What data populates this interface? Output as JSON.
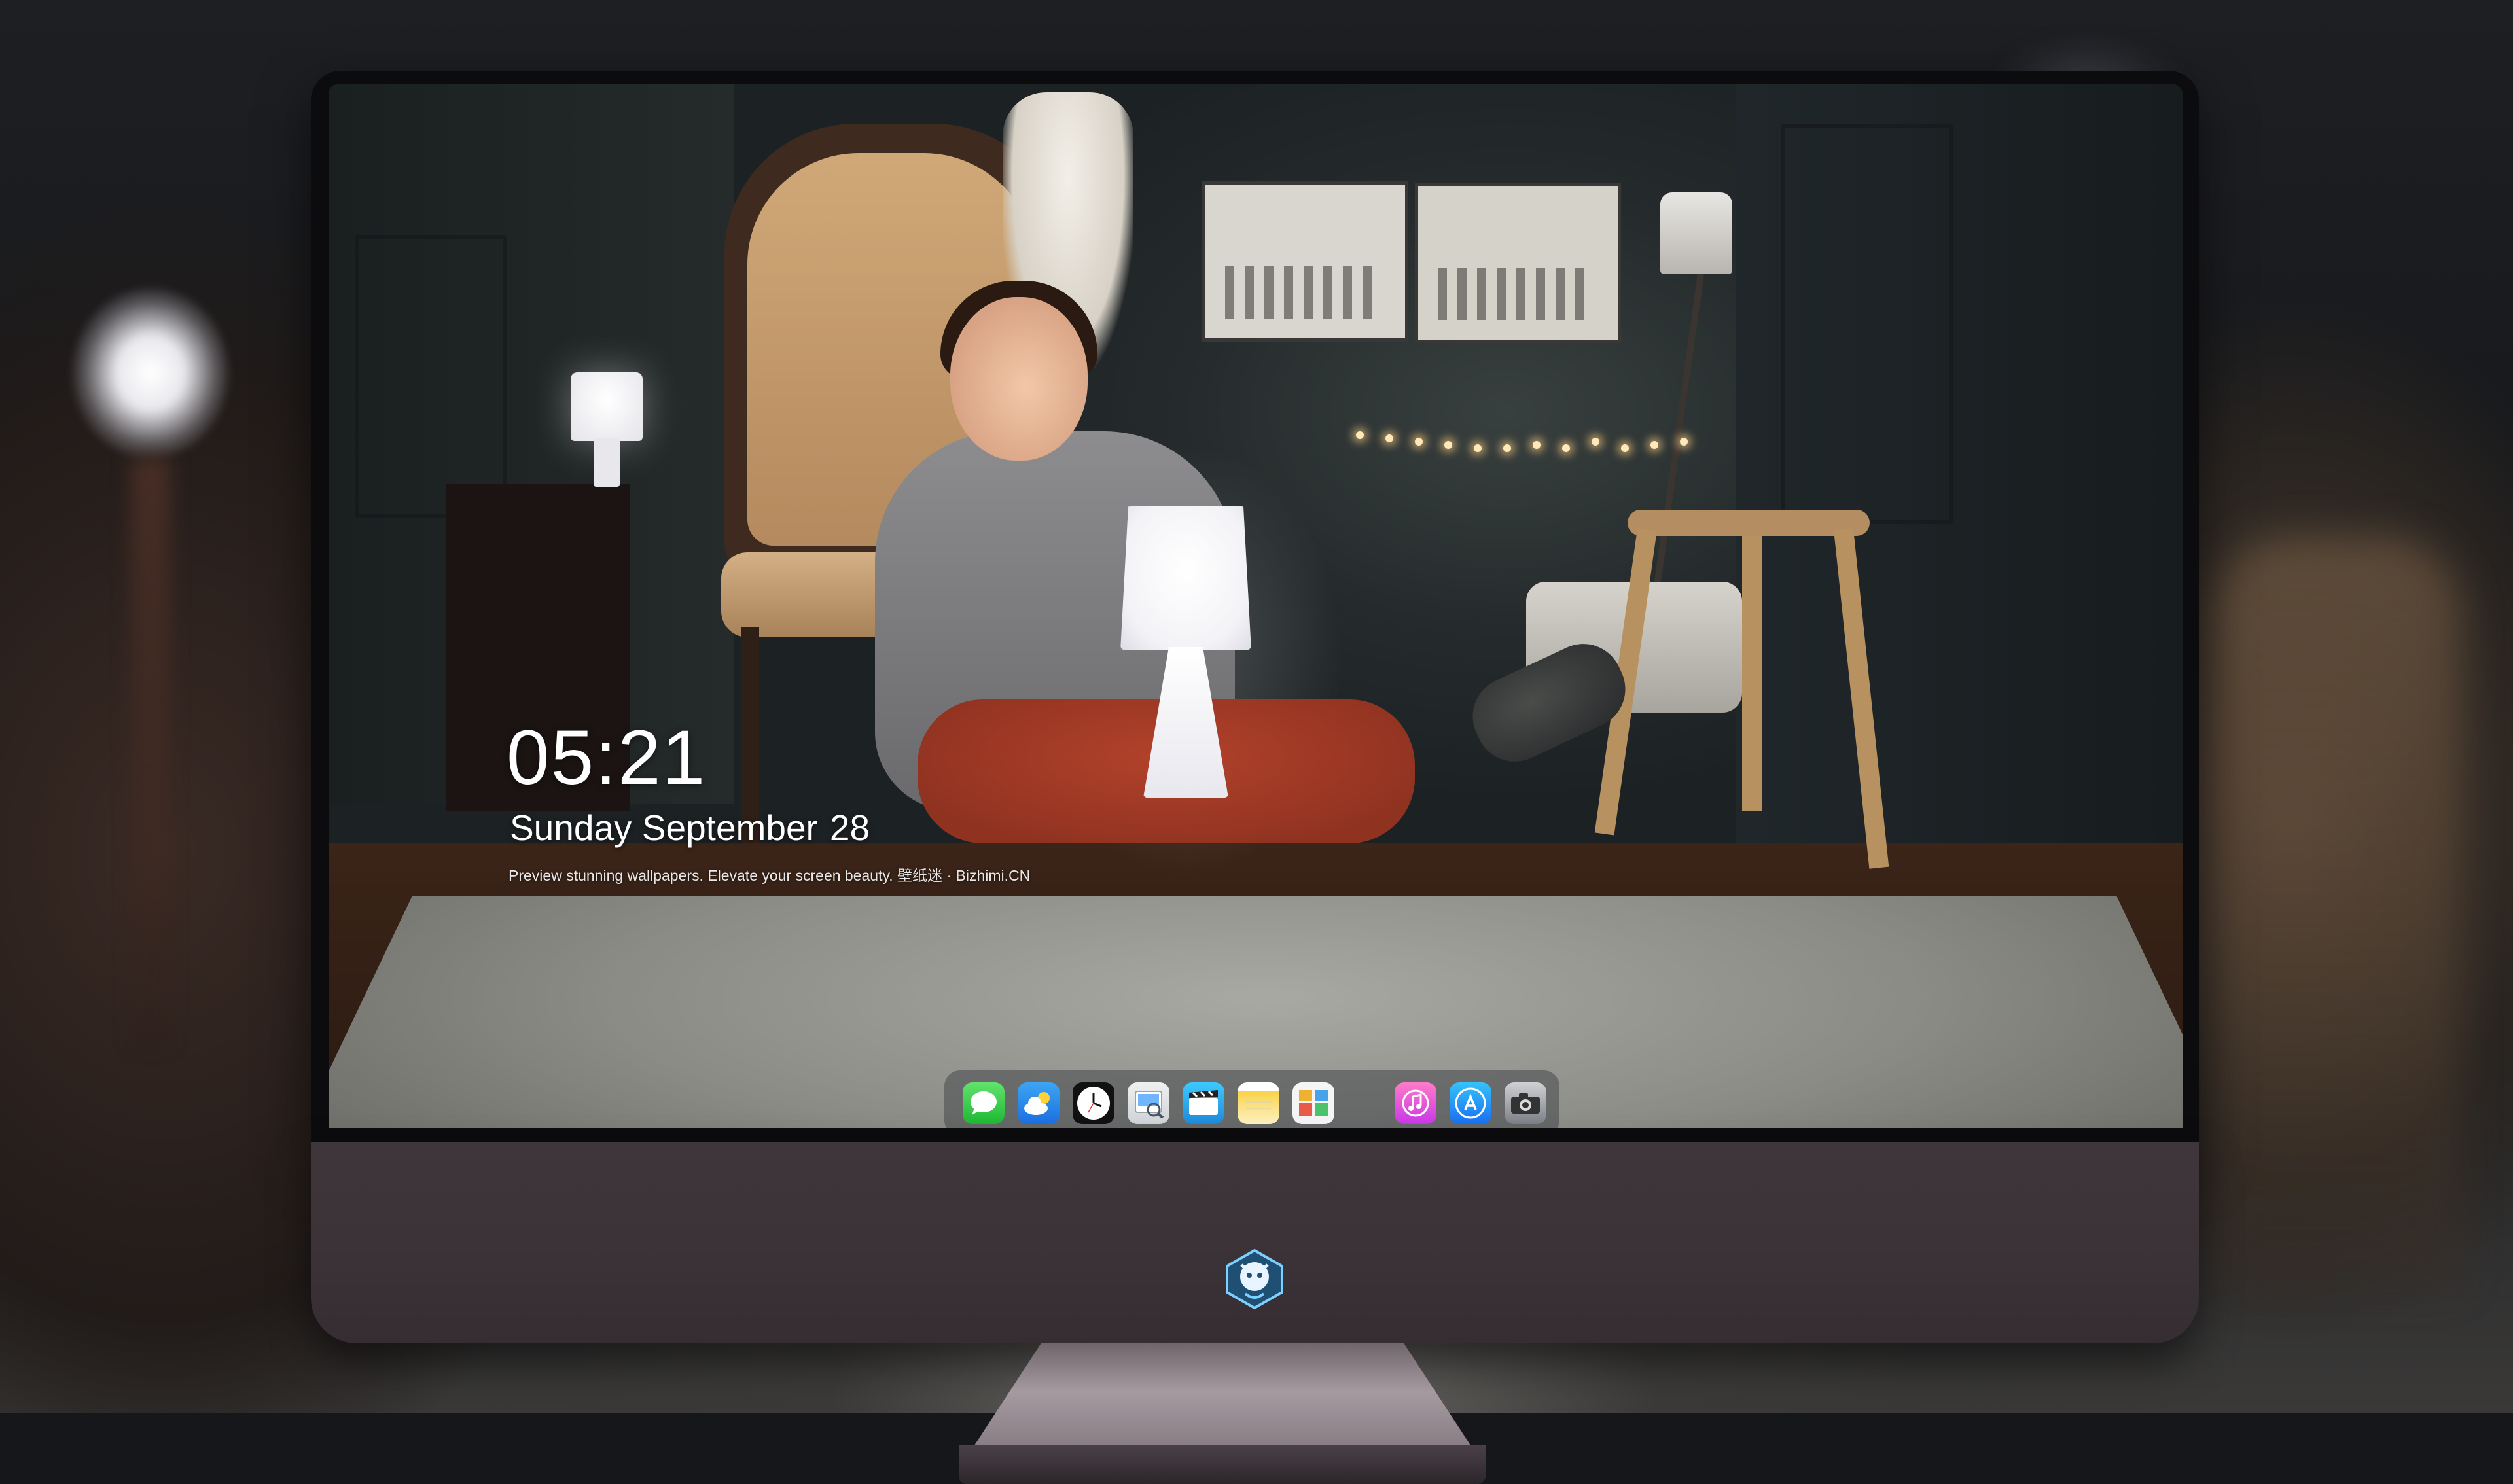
{
  "lock_screen": {
    "time": "05:21",
    "weekday_month": "Sunday September",
    "day": "28",
    "tagline": "Preview stunning wallpapers. Elevate your screen beauty. 壁纸迷 · Bizhimi.CN"
  },
  "dock": {
    "apps": [
      {
        "name": "messages",
        "icon": "message-bubble-icon"
      },
      {
        "name": "weather",
        "icon": "cloud-sun-icon"
      },
      {
        "name": "clock",
        "icon": "clock-icon"
      },
      {
        "name": "preview",
        "icon": "preview-icon"
      },
      {
        "name": "clips",
        "icon": "clapperboard-icon"
      },
      {
        "name": "notes",
        "icon": "notes-icon"
      },
      {
        "name": "photos",
        "icon": "photo-grid-icon"
      }
    ],
    "apps_after_separator": [
      {
        "name": "music",
        "icon": "music-note-icon"
      },
      {
        "name": "app-store",
        "icon": "app-store-icon"
      },
      {
        "name": "camera",
        "icon": "camera-icon"
      }
    ]
  },
  "chin_logo": {
    "icon": "mascot-logo-icon"
  },
  "colors": {
    "chin": "#3b3237",
    "bezel": "#0c0c0e",
    "clock_text": "#ffffff"
  }
}
